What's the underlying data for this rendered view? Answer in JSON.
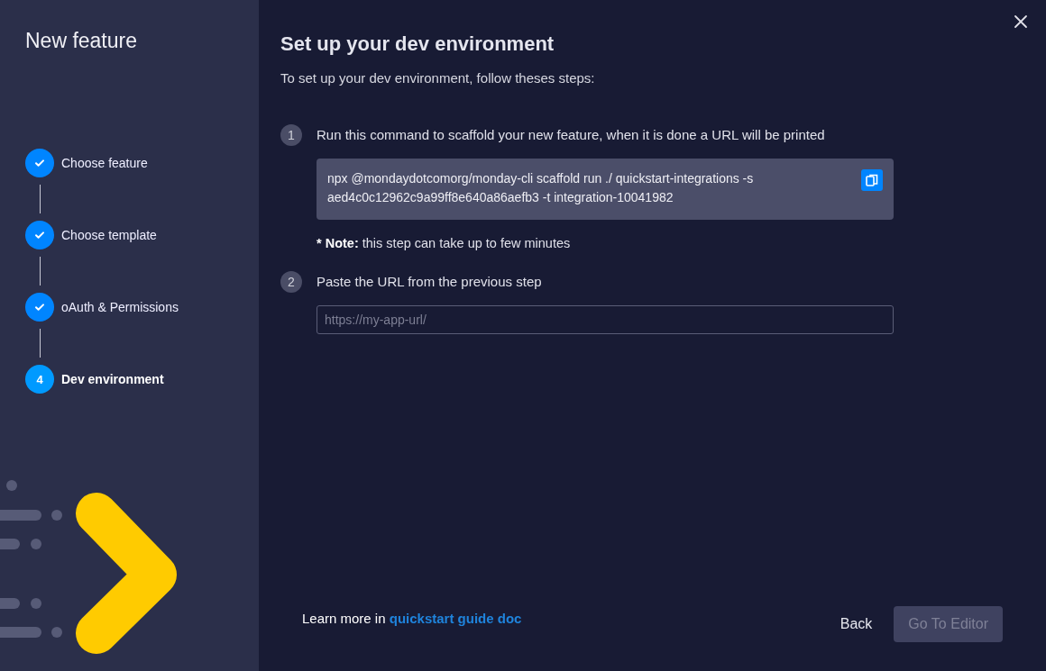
{
  "sidebar": {
    "title": "New feature",
    "steps": [
      {
        "label": "Choose feature",
        "completed": true,
        "selected": false
      },
      {
        "label": "Choose template",
        "completed": true,
        "selected": false
      },
      {
        "label": "oAuth & Permissions",
        "completed": true,
        "selected": false
      },
      {
        "label": "Dev environment",
        "completed": false,
        "selected": true,
        "number": "4"
      }
    ]
  },
  "main": {
    "title": "Set up your dev environment",
    "subtitle": "To set up your dev environment, follow theses steps:",
    "instructions": [
      {
        "kind": "command",
        "number": "1",
        "text": "Run this command to scaffold your new feature, when it is done a URL will be printed",
        "command": "npx @mondaydotcomorg/monday-cli scaffold run ./ quickstart-integrations -s aed4c0c12962c9a99ff8e640a86aefb3 -t integration-10041982",
        "note": {
          "label": "* Note:",
          "text": "this step can take up to few minutes"
        }
      },
      {
        "kind": "input",
        "number": "2",
        "text": "Paste the URL from the previous step",
        "placeholder": "https://my-app-url/"
      }
    ]
  },
  "footer": {
    "learn_more": "Learn more in",
    "link": "quickstart guide doc",
    "back": "Back",
    "go": {
      "label": "Go To Editor",
      "disabled": true
    }
  }
}
